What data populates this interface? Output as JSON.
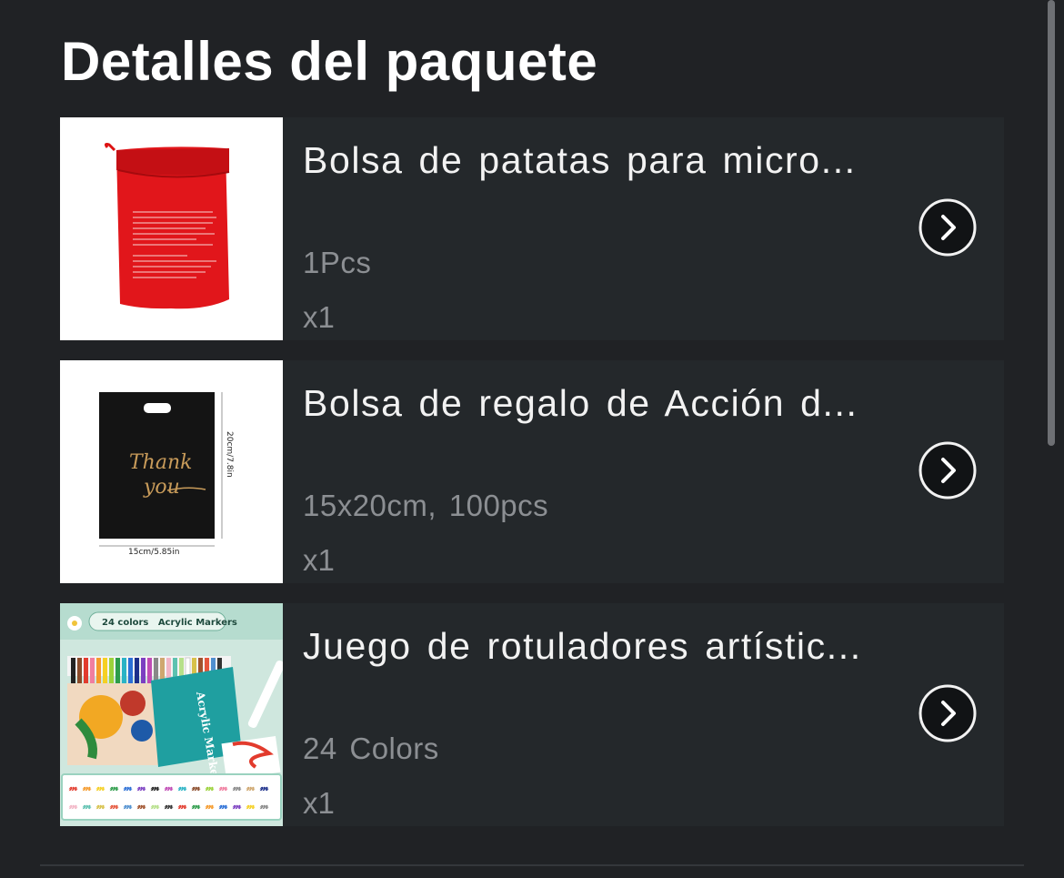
{
  "header": {
    "title": "Detalles del paquete"
  },
  "items": [
    {
      "name": "Bolsa de patatas para micro...",
      "variant": "1Pcs",
      "quantity": "x1",
      "image_icon": "red-potato-bag-image"
    },
    {
      "name": "Bolsa de regalo de Acción d...",
      "variant": "15x20cm, 100pcs",
      "quantity": "x1",
      "image_icon": "black-gift-bag-image",
      "image_text": {
        "thank": "Thank",
        "you": "you",
        "height_label": "20cm/7.8in",
        "width_label": "15cm/5.85in"
      }
    },
    {
      "name": "Juego de rotuladores artístic...",
      "variant": "24 Colors",
      "quantity": "x1",
      "image_icon": "acrylic-markers-set-image",
      "image_text": {
        "banner": "24 colors   Acrylic Markers",
        "box_label": "Acrylic Marker"
      }
    }
  ],
  "colors": {
    "background": "#202225",
    "card": "#24282b",
    "title": "#ffffff",
    "name": "#f2f2f2",
    "muted": "#8c8f93"
  }
}
